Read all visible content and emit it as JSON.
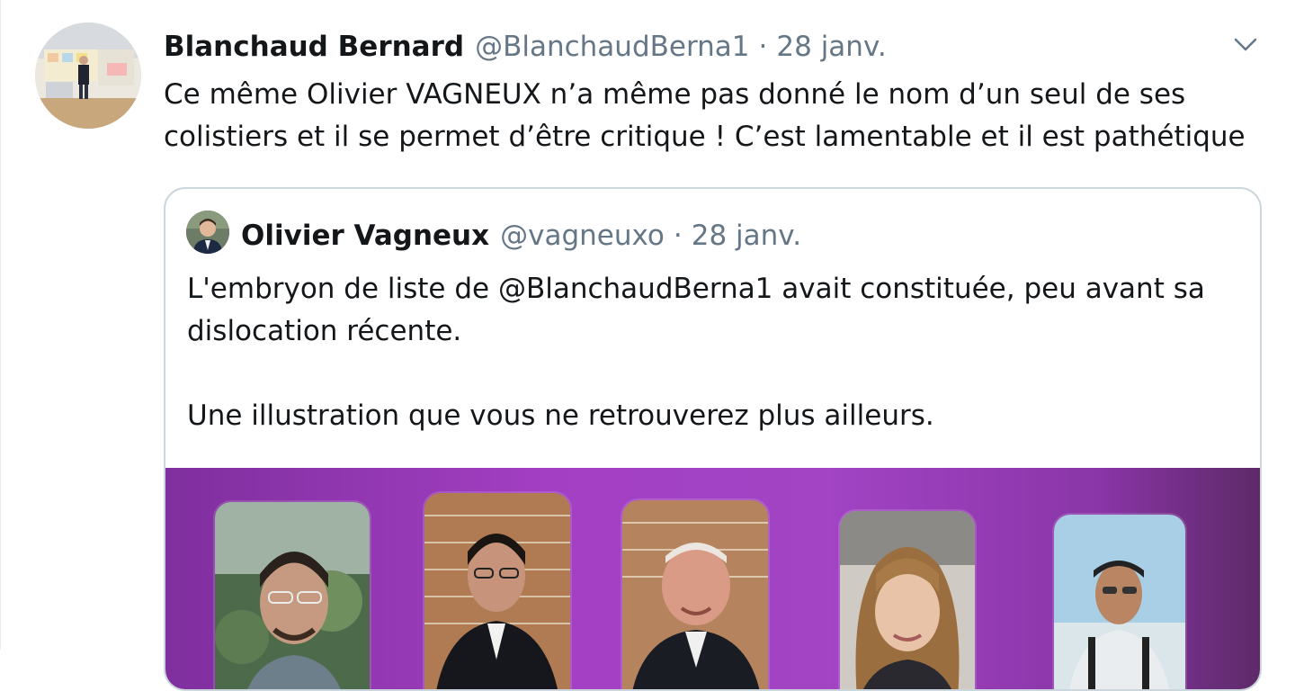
{
  "tweet": {
    "author_name": "Blanchaud Bernard",
    "author_handle": "@BlanchaudBerna1",
    "separator": "·",
    "date": "28 janv.",
    "text": "Ce même Olivier VAGNEUX n’a même pas donné le nom d’un seul de ses colistiers et il se permet d’être critique ! C’est lamentable et il est pathétique",
    "menu_icon": "chevron-down-icon"
  },
  "quoted_tweet": {
    "author_name": "Olivier Vagneux",
    "author_handle": "@vagneuxo",
    "separator": "·",
    "date": "28 janv.",
    "text_paragraph_1": "L'embryon de liste de @BlanchaudBerna1 avait constituée, peu avant sa dislocation récente.",
    "text_paragraph_2": "Une illustration que vous ne retrouverez plus ailleurs."
  },
  "colors": {
    "text_primary": "#14171a",
    "text_secondary": "#657786",
    "border": "#ccd6dd",
    "media_background": "#a33fc3"
  }
}
